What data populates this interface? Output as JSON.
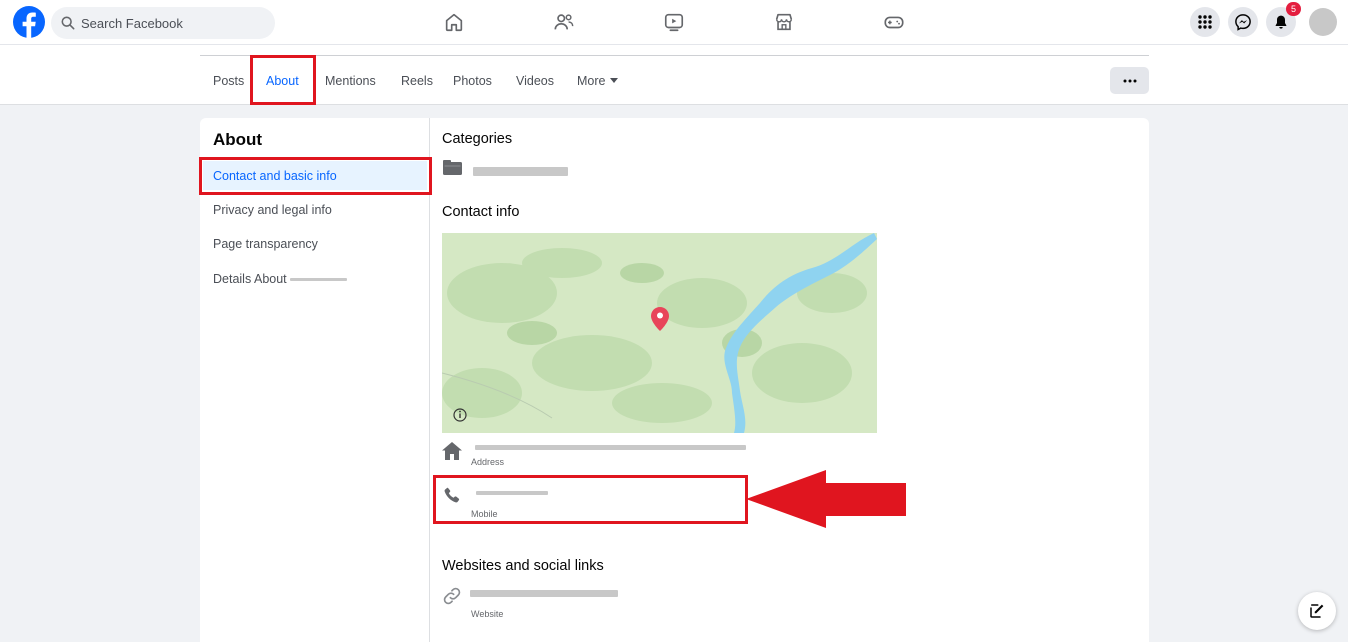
{
  "topbar": {
    "search_placeholder": "Search Facebook",
    "notification_count": "5",
    "nav_icons": [
      "home-icon",
      "friends-icon",
      "watch-icon",
      "marketplace-icon",
      "gaming-icon"
    ],
    "right_icons": [
      "menu-grid-icon",
      "messenger-icon",
      "notifications-icon",
      "avatar"
    ]
  },
  "tabs": {
    "items": [
      {
        "label": "Posts"
      },
      {
        "label": "About"
      },
      {
        "label": "Mentions"
      },
      {
        "label": "Reels"
      },
      {
        "label": "Photos"
      },
      {
        "label": "Videos"
      },
      {
        "label": "More"
      }
    ],
    "active": "About"
  },
  "about": {
    "title": "About",
    "sidebar": [
      {
        "label": "Contact and basic info"
      },
      {
        "label": "Privacy and legal info"
      },
      {
        "label": "Page transparency"
      },
      {
        "label": "Details About"
      }
    ],
    "sections": {
      "categories_title": "Categories",
      "contact_title": "Contact info",
      "address_label": "Address",
      "mobile_label": "Mobile",
      "websites_title": "Websites and social links",
      "website_label": "Website"
    }
  },
  "colors": {
    "brand_blue": "#0866ff",
    "highlight_red": "#e0151f",
    "badge_red": "#e41e3f",
    "map_land": "#d5e8c4",
    "map_water": "#8fd3f0"
  }
}
